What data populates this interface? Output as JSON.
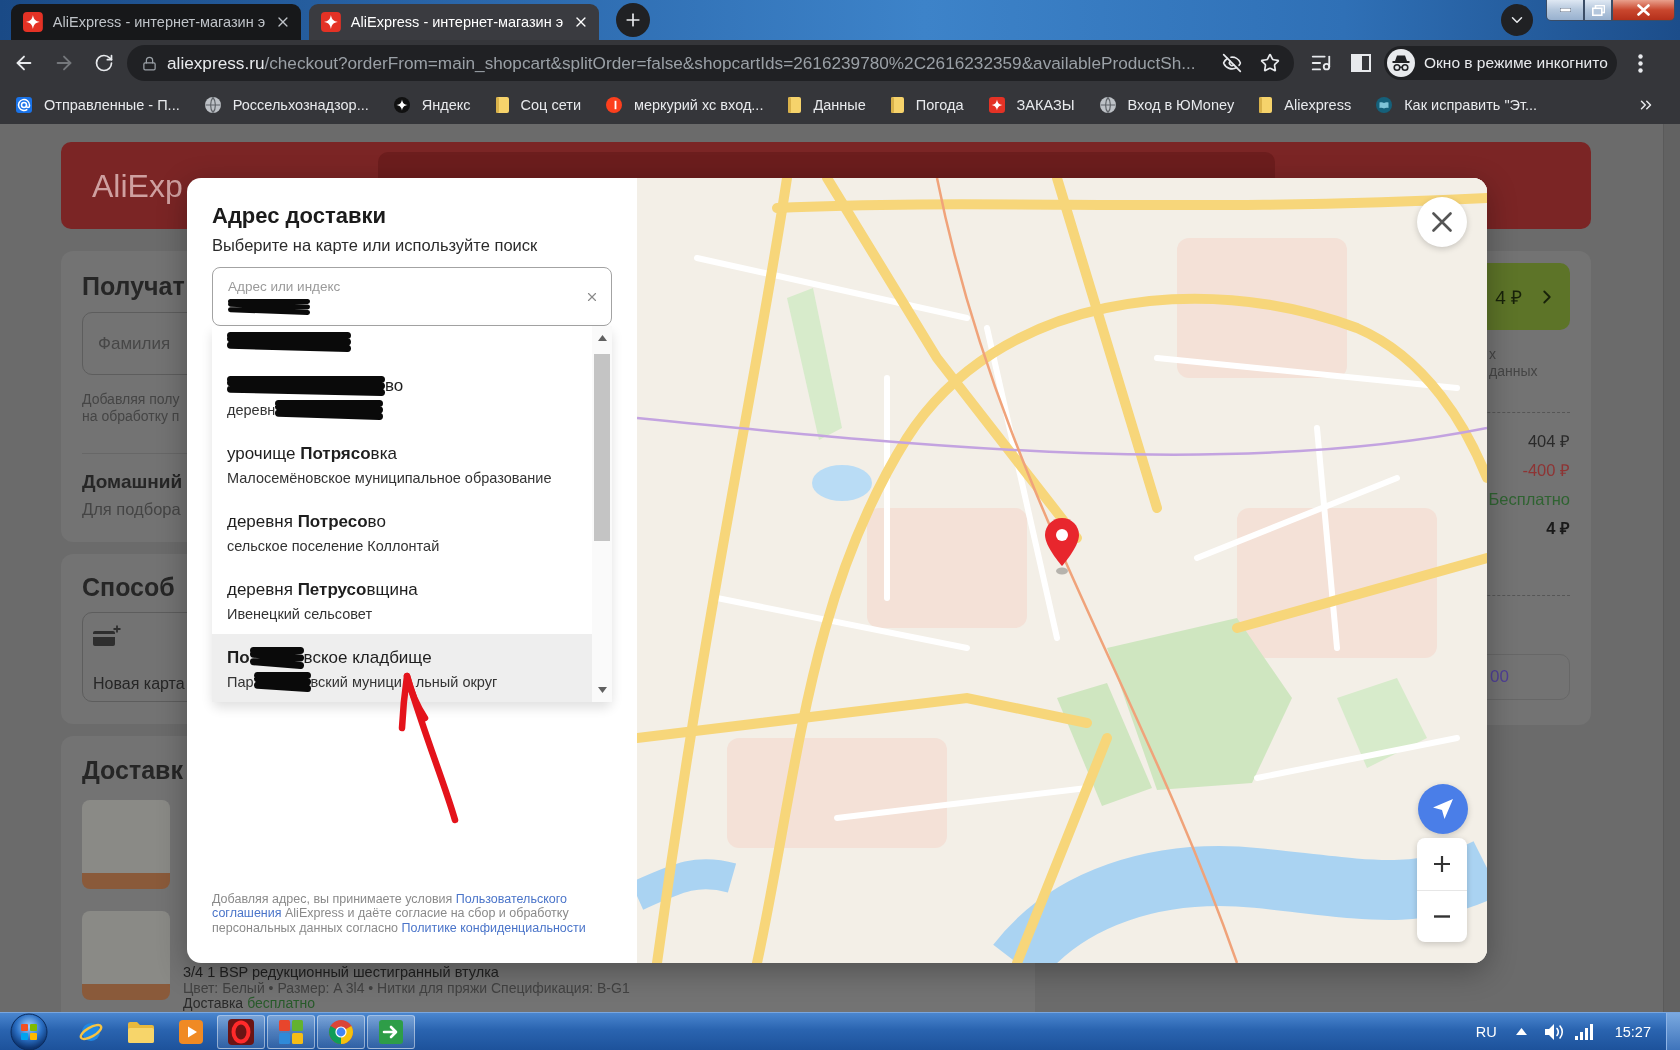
{
  "browser": {
    "tabs": [
      {
        "title": "AliExpress - интернет-магазин э",
        "selected": false
      },
      {
        "title": "AliExpress - интернет-магазин э",
        "selected": true
      }
    ],
    "forward_disabled": true,
    "url": {
      "host": "aliexpress.ru",
      "path": "/checkout?orderFrom=main_shopcart&splitOrder=false&shopcartIds=2616239780%2C2616232359&availableProductSh..."
    },
    "incognito_label": "Окно в режиме инкогнито",
    "bookmarks": [
      {
        "kind": "mail",
        "label": "Отправленные - П..."
      },
      {
        "kind": "globe",
        "label": "Россельхознадзор..."
      },
      {
        "kind": "star-badge",
        "label": "Яндекс"
      },
      {
        "kind": "folder",
        "label": "Соц сети"
      },
      {
        "kind": "red-circle",
        "label": "меркурий хс вход..."
      },
      {
        "kind": "folder",
        "label": "Данные"
      },
      {
        "kind": "folder",
        "label": "Погода"
      },
      {
        "kind": "sparkle-tile",
        "label": "ЗАКАЗЫ"
      },
      {
        "kind": "globe",
        "label": "Вход в ЮMoney"
      },
      {
        "kind": "folder",
        "label": "Aliexpress"
      },
      {
        "kind": "book",
        "label": "Как исправить \"Эт..."
      }
    ]
  },
  "page": {
    "logo": "AliExp",
    "recipient": {
      "heading": "Получат",
      "surname_placeholder": "Фамилия",
      "note_lines": [
        "Добавляя полу",
        "на обработку п"
      ],
      "home_title": "Домашний",
      "home_note": "Для подбора"
    },
    "payment": {
      "heading": "Способ",
      "new_card": "Новая карта"
    },
    "delivery": {
      "heading": "Доставк",
      "products": [
        {
          "kind": "photo-only"
        },
        {
          "kind": "with-text",
          "title_line": "3/4 1 BSP редукционный шестигранный втулка",
          "specs": "Цвет: Белый • Размер: A 3l4 • Нитки для пряжи Спецификация: B-G1",
          "shipping": "Доставка",
          "shipping_value": "бесплатно"
        }
      ]
    },
    "summary": {
      "pay_button": "4 ₽",
      "note_lines": [
        "х",
        "данных"
      ],
      "lines": [
        {
          "kind": "price",
          "value": "404 ₽"
        },
        {
          "kind": "discount",
          "value": "-400 ₽"
        },
        {
          "kind": "free",
          "value": "Бесплатно"
        },
        {
          "kind": "total",
          "value": "4 ₽"
        }
      ],
      "points_field": "00"
    }
  },
  "modal": {
    "title": "Адрес доставки",
    "subtitle": "Выберите на карте или используйте поиск",
    "search": {
      "label": "Адрес или индекс",
      "redacted": true
    },
    "suggestions": [
      {
        "kind": "cut",
        "selected": false,
        "subtitle": [
          {
            "kind": "scribble"
          }
        ]
      },
      {
        "kind": "full",
        "selected": false,
        "title": [
          {
            "kind": "scribble"
          },
          {
            "kind": "text",
            "text": "во"
          }
        ],
        "subtitle": [
          {
            "kind": "text",
            "text": "деревн"
          },
          {
            "kind": "scribble"
          }
        ]
      },
      {
        "kind": "full",
        "selected": false,
        "title": [
          {
            "kind": "text",
            "text": "урочище **Потрясо**вка"
          }
        ],
        "subtitle": [
          {
            "kind": "text",
            "text": "Малосемёновское муниципальное образование"
          }
        ]
      },
      {
        "kind": "full",
        "selected": false,
        "title": [
          {
            "kind": "text",
            "text": "деревня **Потресо**во"
          }
        ],
        "subtitle": [
          {
            "kind": "text",
            "text": "сельское поселение Коллонтай"
          }
        ]
      },
      {
        "kind": "full",
        "selected": false,
        "title": [
          {
            "kind": "text",
            "text": "деревня **Петрусо**вщина"
          }
        ],
        "subtitle": [
          {
            "kind": "text",
            "text": "Ивенецкий сельсовет"
          }
        ]
      },
      {
        "kind": "full",
        "selected": true,
        "title": [
          {
            "kind": "text",
            "text": "**По**"
          },
          {
            "kind": "scribble"
          },
          {
            "kind": "text",
            "text": "вское кладбище"
          }
        ],
        "subtitle": [
          {
            "kind": "text",
            "text": "Пар"
          },
          {
            "kind": "scribble"
          },
          {
            "kind": "text",
            "text": "вский муници"
          },
          {
            "kind": "arrow"
          },
          {
            "kind": "text",
            "text": "льный округ"
          }
        ]
      }
    ],
    "footer": [
      {
        "kind": "text",
        "text": "Добавляя адрес, вы принимаете условия "
      },
      {
        "kind": "link",
        "text": "Пользовательского"
      },
      {
        "kind": "link",
        "text": "соглашения"
      },
      {
        "kind": "text",
        "text": " AliExpress и даёте согласие на сбор и обработку персональных данных согласно "
      },
      {
        "kind": "link",
        "text": "Политике конфиденциальности"
      }
    ]
  },
  "taskbar": {
    "apps": [
      {
        "kind": "orbit",
        "running": false
      },
      {
        "kind": "folder",
        "running": false
      },
      {
        "kind": "player",
        "running": false
      },
      {
        "kind": "ring",
        "running": true
      },
      {
        "kind": "tiles",
        "running": true
      },
      {
        "kind": "wheel",
        "running": true
      },
      {
        "kind": "arrow-tile",
        "running": true
      }
    ],
    "language": "RU",
    "clock": "15:27"
  }
}
